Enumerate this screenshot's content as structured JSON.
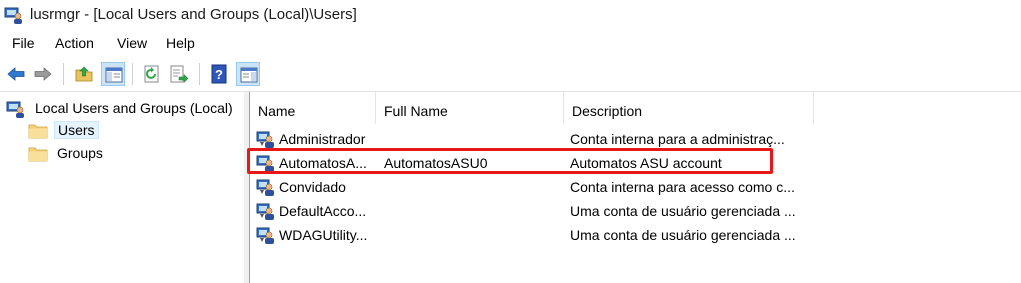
{
  "window": {
    "title": "lusrmgr - [Local Users and Groups (Local)\\Users]"
  },
  "menu": {
    "items": [
      "File",
      "Action",
      "View",
      "Help"
    ]
  },
  "toolbar": {
    "buttons": [
      "back-icon",
      "forward-icon",
      "up-folder-icon",
      "show-hide-tree-icon",
      "refresh-icon",
      "export-list-icon",
      "help-icon",
      "show-hide-action-pane-icon"
    ]
  },
  "tree": {
    "root": "Local Users and Groups (Local)",
    "children": [
      "Users",
      "Groups"
    ],
    "selected": "Users"
  },
  "list": {
    "columns": [
      "Name",
      "Full Name",
      "Description"
    ],
    "rows": [
      {
        "name": "Administrador",
        "full_name": "",
        "description": "Conta interna para a administraç..."
      },
      {
        "name": "AutomatosA...",
        "full_name": "AutomatosASU0",
        "description": "Automatos ASU account"
      },
      {
        "name": "Convidado",
        "full_name": "",
        "description": "Conta interna para acesso como c..."
      },
      {
        "name": "DefaultAcco...",
        "full_name": "",
        "description": "Uma conta de usuário gerenciada ..."
      },
      {
        "name": "WDAGUtility...",
        "full_name": "",
        "description": "Uma conta de usuário gerenciada ..."
      }
    ]
  },
  "colors": {
    "highlight": "#e81818",
    "selection": "#e5f3ff",
    "folder": "#f4d27a"
  }
}
